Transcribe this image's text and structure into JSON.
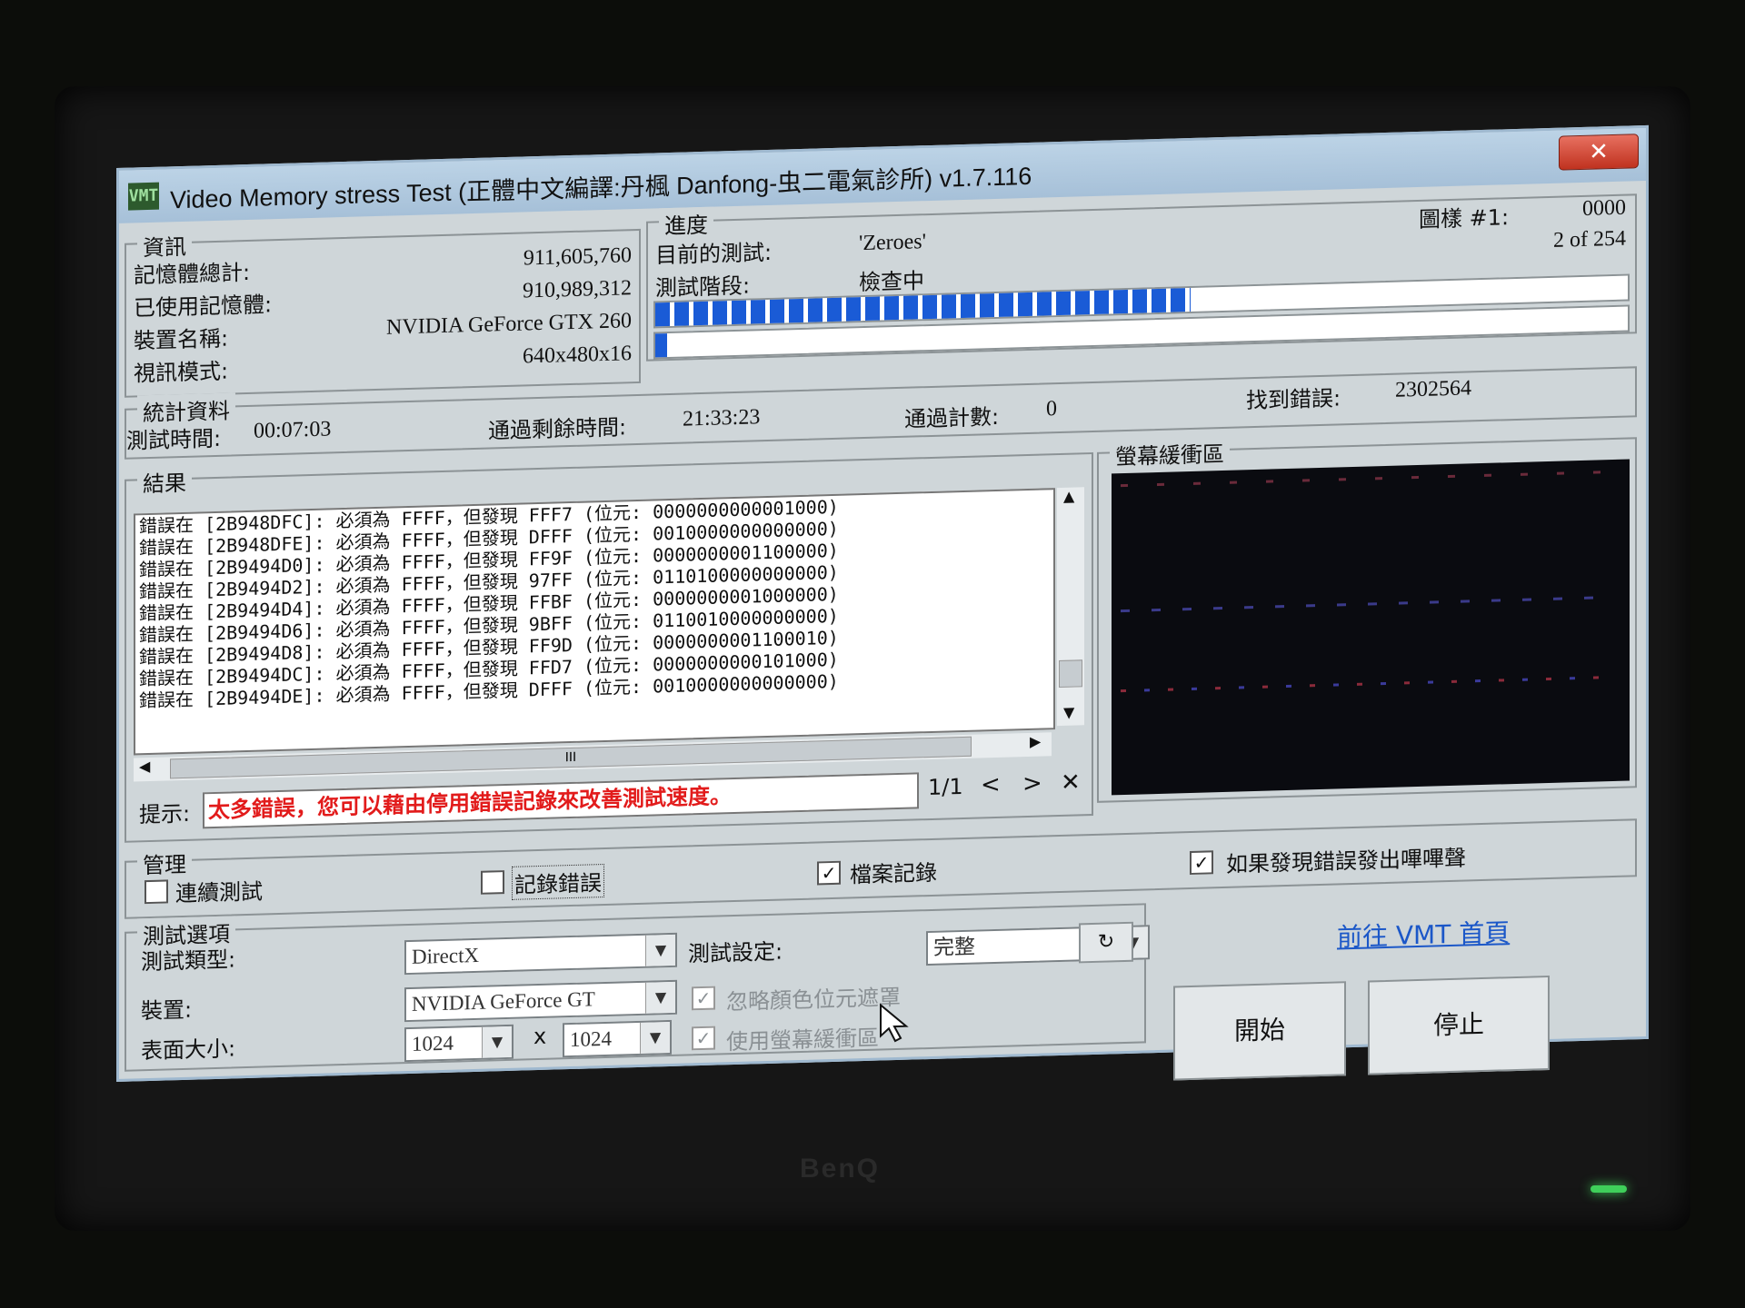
{
  "window": {
    "title": "Video Memory stress Test (正體中文編譯:丹楓 Danfong-虫二電氣診所) v1.7.116",
    "close_label": "✕",
    "app_icon": "VMT"
  },
  "info": {
    "group_label": "資訊",
    "total_memory_label": "記憶體總計:",
    "total_memory_value": "911,605,760",
    "used_memory_label": "已使用記憶體:",
    "used_memory_value": "910,989,312",
    "device_label": "裝置名稱:",
    "device_value": "NVIDIA GeForce GTX 260",
    "video_mode_label": "視訊模式:",
    "video_mode_value": "640x480x16"
  },
  "progress": {
    "group_label": "進度",
    "current_test_label": "目前的測試:",
    "current_test_value": "'Zeroes'",
    "stage_label": "測試階段:",
    "stage_value": "檢查中",
    "pattern_label": "圖樣 #1:",
    "pattern_value": "0000",
    "count_text": "2 of 254",
    "bar1_fraction": 0.55,
    "bar2_fraction": 0.012
  },
  "stats": {
    "group_label": "統計資料",
    "test_time_label": "測試時間:",
    "test_time_value": "00:07:03",
    "remaining_label": "通過剩餘時間:",
    "remaining_value": "21:33:23",
    "pass_count_label": "通過計數:",
    "pass_count_value": "0",
    "errors_label": "找到錯誤:",
    "errors_value": "2302564"
  },
  "results": {
    "group_label": "結果",
    "lines": [
      "錯誤在 [2B948DFC]: 必須為 FFFF，但發現 FFF7 (位元: 0000000000001000)",
      "錯誤在 [2B948DFE]: 必須為 FFFF，但發現 DFFF (位元: 0010000000000000)",
      "錯誤在 [2B9494D0]: 必須為 FFFF，但發現 FF9F (位元: 0000000001100000)",
      "錯誤在 [2B9494D2]: 必須為 FFFF，但發現 97FF (位元: 0110100000000000)",
      "錯誤在 [2B9494D4]: 必須為 FFFF，但發現 FFBF (位元: 0000000001000000)",
      "錯誤在 [2B9494D6]: 必須為 FFFF，但發現 9BFF (位元: 0110010000000000)",
      "錯誤在 [2B9494D8]: 必須為 FFFF，但發現 FF9D (位元: 0000000001100010)",
      "錯誤在 [2B9494DC]: 必須為 FFFF，但發現 FFD7 (位元: 0000000000101000)",
      "錯誤在 [2B9494DE]: 必須為 FFFF，但發現 DFFF (位元: 0010000000000000)"
    ],
    "hscroll_grip": "III",
    "hint_label": "提示:",
    "hint_text": "太多錯誤，您可以藉由停用錯誤記錄來改善測試速度。",
    "page": "1/1",
    "prev": "<",
    "next": ">",
    "dismiss": "✕"
  },
  "screen_buffer": {
    "group_label": "螢幕緩衝區"
  },
  "manage": {
    "group_label": "管理",
    "continuous_label": "連續測試",
    "continuous_checked": false,
    "log_errors_label": "記錄錯誤",
    "log_errors_checked": false,
    "file_log_label": "檔案記錄",
    "file_log_checked": true,
    "beep_label": "如果發現錯誤發出嗶嗶聲",
    "beep_checked": true
  },
  "options": {
    "group_label": "測試選項",
    "test_type_label": "測試類型:",
    "test_type_value": "DirectX",
    "test_setting_label": "測試設定:",
    "test_setting_value": "完整",
    "refresh_icon": "↻",
    "device_label": "裝置:",
    "device_value": "NVIDIA GeForce GT",
    "ignore_color_label": "忽略顏色位元遮罩",
    "surface_label": "表面大小:",
    "width_value": "1024",
    "times": "x",
    "height_value": "1024",
    "use_screen_label": "使用螢幕緩衝區",
    "check_mark": "✓"
  },
  "actions": {
    "homepage_link": "前往 VMT 首頁",
    "start_label": "開始",
    "stop_label": "停止"
  },
  "monitor": {
    "brand": "BenQ"
  }
}
